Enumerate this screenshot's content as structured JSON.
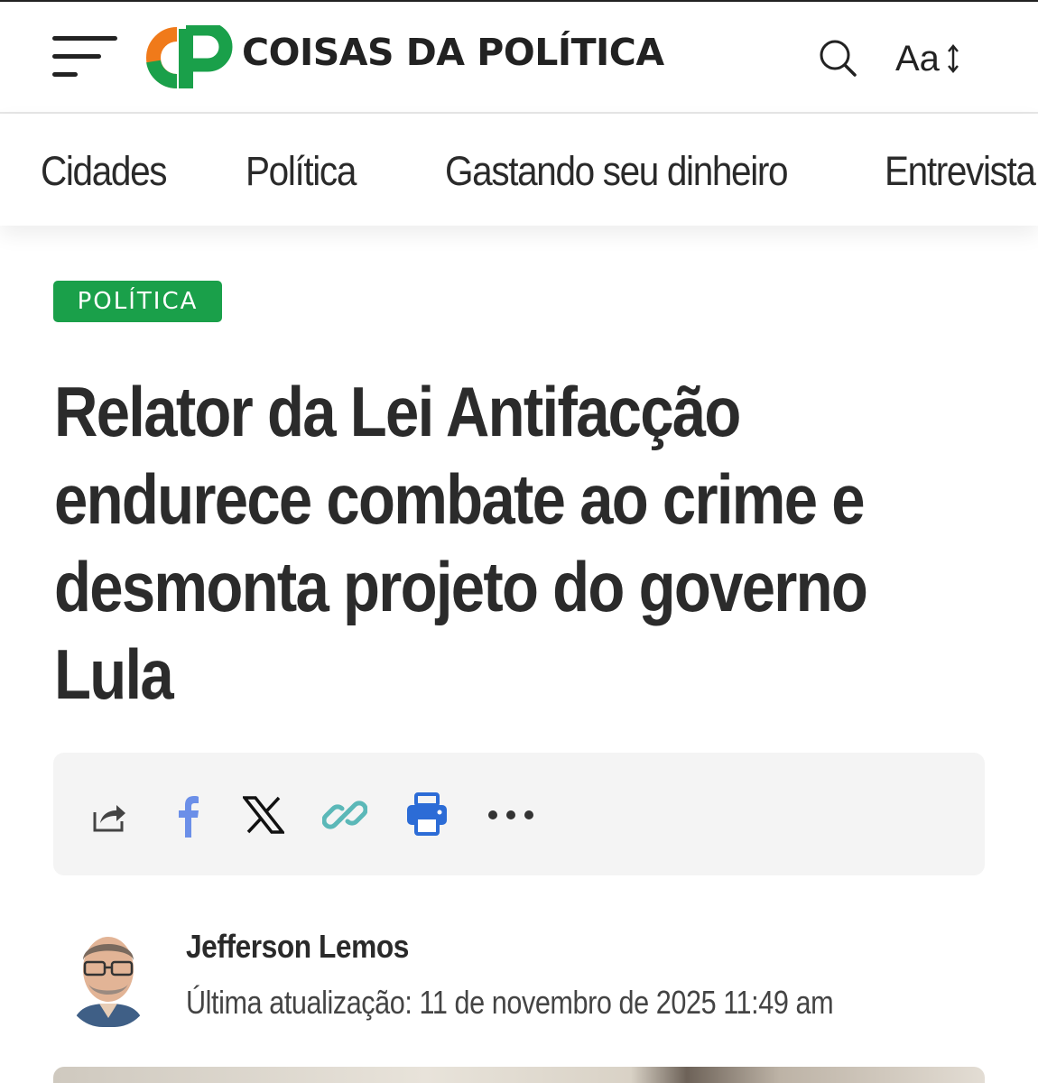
{
  "header": {
    "logo_mark": "CP",
    "site_name": "COISAS DA POLÍTICA",
    "font_size_label": "Aa"
  },
  "nav": {
    "items": [
      {
        "label": "Cidades"
      },
      {
        "label": "Política"
      },
      {
        "label": "Gastando seu dinheiro"
      },
      {
        "label": "Entrevista"
      }
    ]
  },
  "article": {
    "category": "POLÍTICA",
    "title": "Relator da Lei Antifacção endurece combate ao crime e desmonta projeto do governo Lula",
    "author": "Jefferson Lemos",
    "updated": "Última atualização: 11 de novembro de 2025 11:49 am"
  },
  "share": {
    "icons": [
      "share-icon",
      "facebook-icon",
      "x-icon",
      "link-icon",
      "print-icon",
      "more-icon"
    ]
  },
  "colors": {
    "brand_green": "#1aa04a",
    "brand_orange": "#f07a1a",
    "facebook_blue": "#6b8fe8",
    "link_teal": "#5bb8b8",
    "print_blue": "#2c6cd6"
  }
}
